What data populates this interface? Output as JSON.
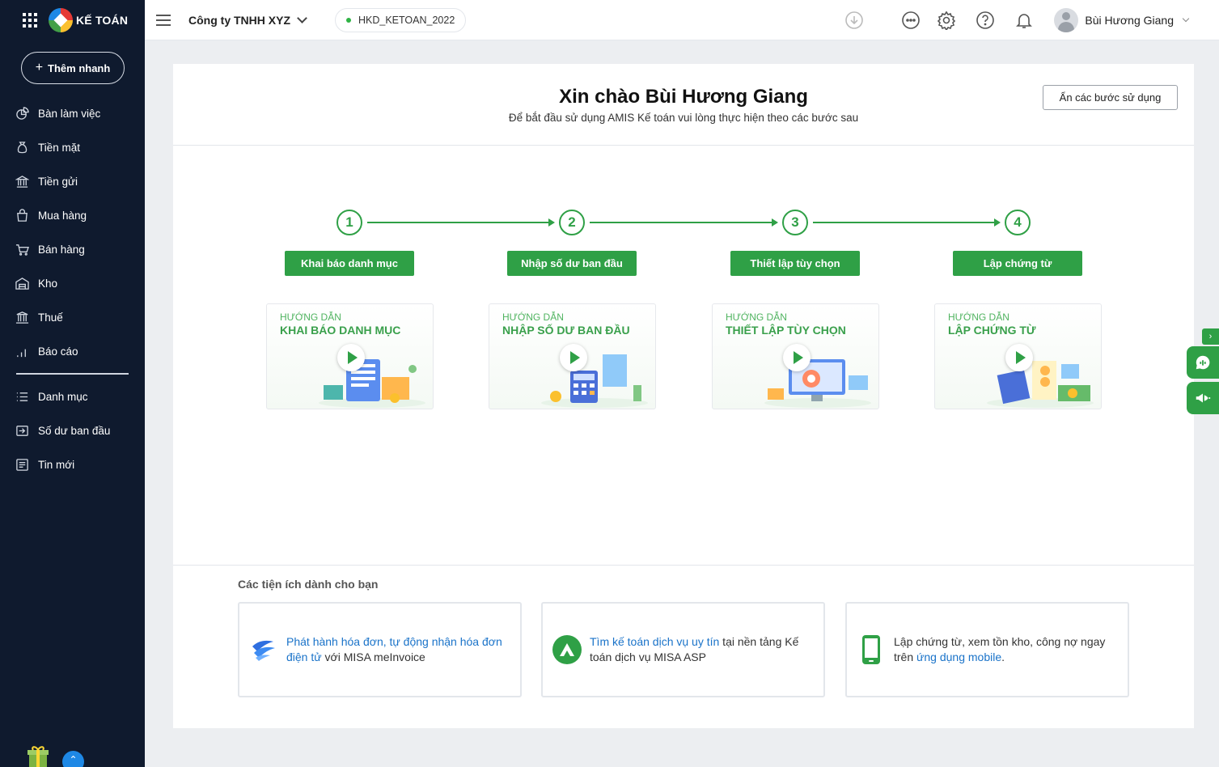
{
  "app": {
    "logo_text": "KẾ TOÁN",
    "quick_add_label": "Thêm nhanh"
  },
  "sidebar": {
    "items": [
      {
        "label": "Bàn làm việc",
        "icon": "dashboard-icon"
      },
      {
        "label": "Tiền mặt",
        "icon": "money-bag-icon"
      },
      {
        "label": "Tiền gửi",
        "icon": "bank-icon"
      },
      {
        "label": "Mua hàng",
        "icon": "shopping-bag-icon"
      },
      {
        "label": "Bán hàng",
        "icon": "cart-icon"
      },
      {
        "label": "Kho",
        "icon": "warehouse-icon"
      },
      {
        "label": "Thuế",
        "icon": "tax-building-icon"
      },
      {
        "label": "Báo cáo",
        "icon": "bar-chart-icon"
      }
    ],
    "items2": [
      {
        "label": "Danh mục",
        "icon": "list-icon"
      },
      {
        "label": "Số dư ban đầu",
        "icon": "opening-balance-icon"
      },
      {
        "label": "Tin mới",
        "icon": "news-icon"
      }
    ]
  },
  "header": {
    "company": "Công ty TNHH XYZ",
    "database": "HKD_KETOAN_2022",
    "user_name": "Bùi Hương Giang"
  },
  "welcome": {
    "title": "Xin chào Bùi Hương Giang",
    "subtitle": "Để bắt đầu sử dụng AMIS Kế toán vui lòng thực hiện theo các bước sau",
    "hide_button": "Ẩn các bước sử dụng"
  },
  "steps": [
    {
      "number": "1",
      "button": "Khai báo danh mục",
      "video_kicker": "HƯỚNG DẪN",
      "video_title": "KHAI BÁO DANH MỤC"
    },
    {
      "number": "2",
      "button": "Nhập số dư ban đầu",
      "video_kicker": "HƯỚNG DẪN",
      "video_title": "NHẬP SỐ DƯ BAN ĐẦU"
    },
    {
      "number": "3",
      "button": "Thiết lập tùy chọn",
      "video_kicker": "HƯỚNG DẪN",
      "video_title": "THIẾT LẬP TÙY CHỌN"
    },
    {
      "number": "4",
      "button": "Lập chứng từ",
      "video_kicker": "HƯỚNG DẪN",
      "video_title": "LẬP CHỨNG TỪ"
    }
  ],
  "utilities": {
    "title": "Các tiện ích dành cho bạn",
    "cards": [
      {
        "link": "Phát hành hóa đơn, tự động nhận hóa đơn điện tử",
        "text_after": " với MISA meInvoice",
        "text_before": ""
      },
      {
        "link": "Tìm kế toán dịch vụ uy tín",
        "text_after": " tại nền tảng Kế toán dịch vụ MISA ASP",
        "text_before": ""
      },
      {
        "text_before": "Lập chứng từ, xem tồn kho, công nợ ngay trên ",
        "link": "ứng dụng mobile",
        "text_after": "."
      }
    ]
  },
  "colors": {
    "sidebar_bg": "#0f1a2e",
    "accent_green": "#2fa046",
    "link_blue": "#1a73c9"
  }
}
